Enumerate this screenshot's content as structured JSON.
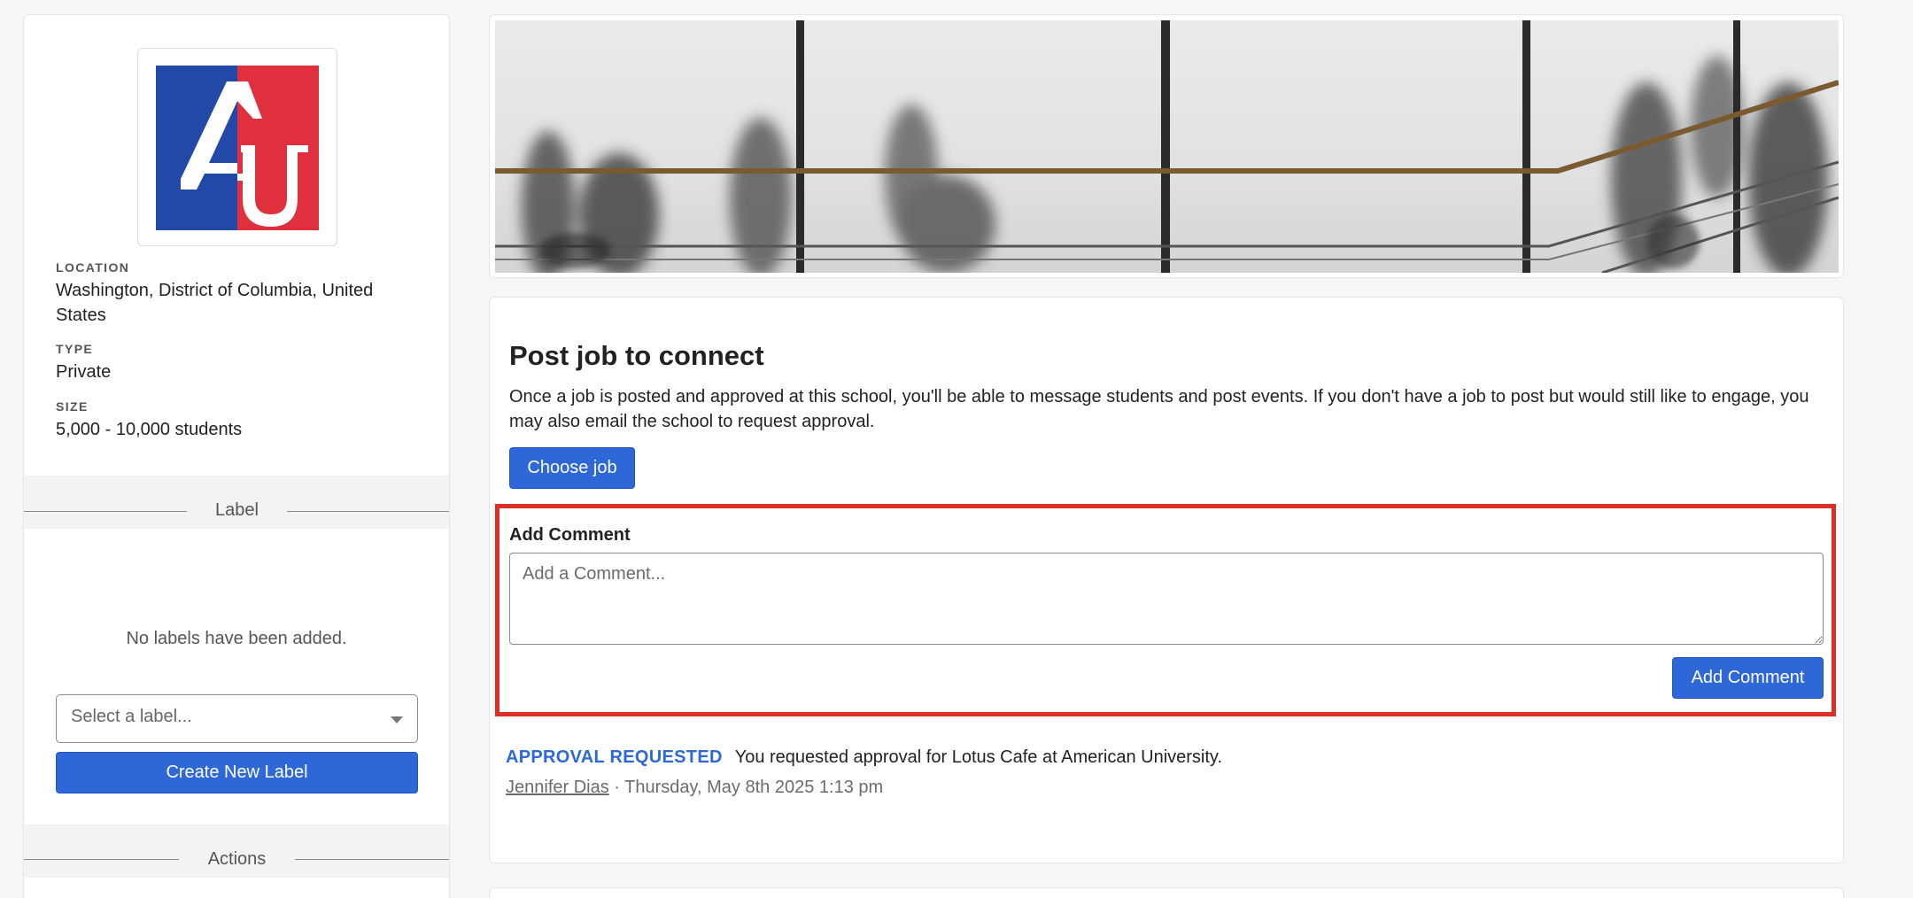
{
  "school": {
    "logo_text": "AU",
    "location_label": "LOCATION",
    "location_value": "Washington, District of Columbia, United States",
    "type_label": "TYPE",
    "type_value": "Private",
    "size_label": "SIZE",
    "size_value": "5,000 - 10,000 students"
  },
  "labels_section": {
    "heading": "Label",
    "empty_text": "No labels have been added.",
    "select_placeholder": "Select a label...",
    "create_button": "Create New Label"
  },
  "actions_section": {
    "heading": "Actions"
  },
  "post_job": {
    "title": "Post job to connect",
    "description": "Once a job is posted and approved at this school, you'll be able to message students and post events. If you don't have a job to post but would still like to engage, you may also email the school to request approval.",
    "choose_button": "Choose job"
  },
  "comment": {
    "heading": "Add Comment",
    "placeholder": "Add a Comment...",
    "value": "",
    "submit_button": "Add Comment"
  },
  "activity": {
    "badge": "APPROVAL REQUESTED",
    "message": "You requested approval for Lotus Cafe at American University.",
    "author": "Jennifer Dias",
    "separator": " · ",
    "timestamp": "Thursday, May 8th 2025 1:13 pm"
  },
  "colors": {
    "primary_blue": "#2e67d8",
    "highlight_red": "#dc2f26",
    "logo_blue": "#2249a8",
    "logo_red": "#e0303d"
  }
}
